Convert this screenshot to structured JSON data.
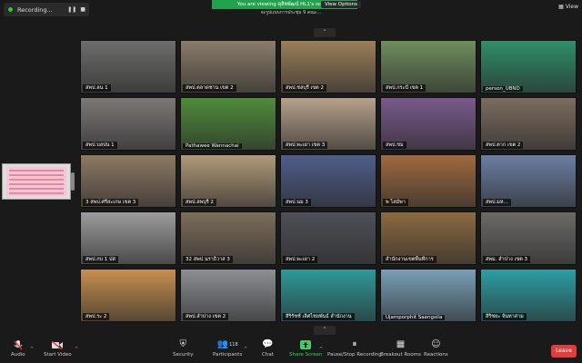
{
  "recording": {
    "label": "Recording..."
  },
  "banner": {
    "text": "You are viewing ดุสิตพัฒน์ HL1's screen"
  },
  "view_options": {
    "label": "View Options"
  },
  "subtitle": {
    "text": "จะรูปแบบการประชุม 9 คณะ..."
  },
  "view_button": {
    "label": "View"
  },
  "tiles": [
    {
      "label": "สพป.ลน 1",
      "bg": "#6d6e6a"
    },
    {
      "label": "สพป.ตลาดชาน เขต 2",
      "bg": "#8a7d6a"
    },
    {
      "label": "สพป.ชลบุรี เขต 2",
      "bg": "#9b7f5a"
    },
    {
      "label": "สพป.กระบี่ เขต 1",
      "bg": "#6f8e5d"
    },
    {
      "label": "person_UBND",
      "bg": "#2f8f6a"
    },
    {
      "label": "สพป.บลปน 1",
      "bg": "#7c7876"
    },
    {
      "label": "Pathawee Wannachai",
      "bg": "#4f8c3a"
    },
    {
      "label": "สพป.พะเยา เขต 3",
      "bg": "#b7a18b"
    },
    {
      "label": "สพป.ชม",
      "bg": "#7a5a8c"
    },
    {
      "label": "สพป.ตาก เขต 2",
      "bg": "#7b6d60"
    },
    {
      "label": "3 สพป.ศรีสะเกษ เขต 3",
      "bg": "#8e7a64"
    },
    {
      "label": "สพป.ลพบุรี 2",
      "bg": "#b09a7a"
    },
    {
      "label": "สพป.นม 3",
      "bg": "#4f5e8a"
    },
    {
      "label": "พ ไสมัพา",
      "bg": "#a06a40"
    },
    {
      "label": "สพป.มห...",
      "bg": "#6b7fa3"
    },
    {
      "label": "สพป.กบ 1 ปส",
      "bg": "#9c9c9c"
    },
    {
      "label": "32 สพป.นราธิวาส 3",
      "bg": "#7c6e5a"
    },
    {
      "label": "สพป.พะเยา 2",
      "bg": "#4f5058"
    },
    {
      "label": "สำนักงานเขตพื้นที่การ",
      "bg": "#8c6a40"
    },
    {
      "label": "สพม. ลำปาง เขต 3",
      "bg": "#6c6a66"
    },
    {
      "label": "สพป.ระ 2",
      "bg": "#c98f4e"
    },
    {
      "label": "สพป.ลำปาง เขต 2",
      "bg": "#8d8f94"
    },
    {
      "label": "สิริรัชช์ เลิศไชยพันธ์ สำนักงาน",
      "bg": "#2d9a9a"
    },
    {
      "label": "Ujamporphit Saengsila",
      "bg": "#7aa0b8"
    },
    {
      "label": "สิริชยะ จันทาสาม",
      "bg": "#2aa0a6"
    }
  ],
  "toolbar": {
    "audio": "Audio",
    "start_video": "Start Video",
    "security": "Security",
    "participants": "Participants",
    "participants_count": "118",
    "chat": "Chat",
    "share_screen": "Share Screen",
    "pause_recording": "Pause/Stop Recording",
    "breakout_rooms": "Breakout Rooms",
    "reactions": "Reactions",
    "leave": "Leave"
  },
  "icons": {
    "audio": "microphone-muted-icon",
    "video": "video-off-icon",
    "security": "shield-icon",
    "participants": "people-icon",
    "chat": "chat-bubble-icon",
    "share": "share-screen-icon",
    "pause": "pause-icon",
    "breakout": "grid-icon",
    "reactions": "smiley-plus-icon"
  },
  "colors": {
    "share_green": "#3ecf5c",
    "leave_red": "#e03e3e",
    "banner_green": "#23a24d"
  }
}
